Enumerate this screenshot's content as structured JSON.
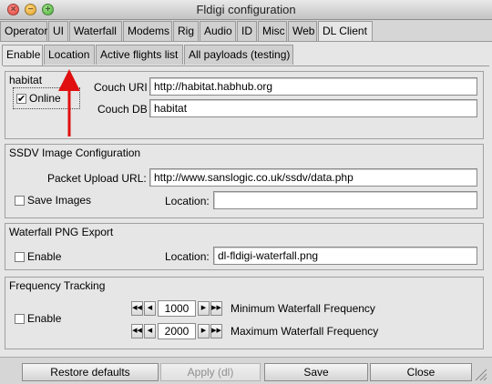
{
  "window": {
    "title": "Fldigi configuration"
  },
  "main_tabs": [
    "Operator",
    "UI",
    "Waterfall",
    "Modems",
    "Rig",
    "Audio",
    "ID",
    "Misc",
    "Web",
    "DL Client"
  ],
  "active_main_tab": "DL Client",
  "sub_tabs": [
    "Enable",
    "Location",
    "Active flights list",
    "All payloads (testing)"
  ],
  "active_sub_tab": "Enable",
  "habitat": {
    "title": "habitat",
    "online_label": "Online",
    "online_checked": true,
    "couch_uri_label": "Couch URI",
    "couch_uri_value": "http://habitat.habhub.org",
    "couch_db_label": "Couch DB",
    "couch_db_value": "habitat"
  },
  "ssdv": {
    "title": "SSDV Image Configuration",
    "upload_url_label": "Packet Upload URL:",
    "upload_url_value": "http://www.sanslogic.co.uk/ssdv/data.php",
    "save_images_label": "Save Images",
    "save_images_checked": false,
    "location_label": "Location:",
    "location_value": ""
  },
  "waterfall_png": {
    "title": "Waterfall PNG Export",
    "enable_label": "Enable",
    "enable_checked": false,
    "location_label": "Location:",
    "location_value": "dl-fldigi-waterfall.png"
  },
  "freq_tracking": {
    "title": "Frequency Tracking",
    "enable_label": "Enable",
    "enable_checked": false,
    "min_value": "1000",
    "min_label": "Minimum Waterfall Frequency",
    "max_value": "2000",
    "max_label": "Maximum Waterfall Frequency"
  },
  "buttons": {
    "restore_defaults": "Restore defaults",
    "apply": "Apply (dl)",
    "save": "Save",
    "close": "Close"
  },
  "colors": {
    "annotation_arrow": "#e01010"
  }
}
